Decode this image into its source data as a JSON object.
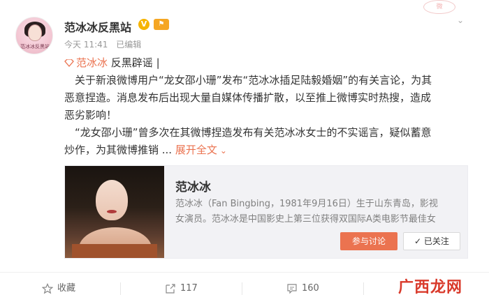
{
  "header": {
    "avatar_caption": "范冰冰反黑站",
    "author_name": "范冰冰反黑站",
    "verified_badge": "V",
    "level_badge": "⚑",
    "time": "今天 11:41",
    "edited": "已编辑"
  },
  "body": {
    "line1_name": "范冰冰",
    "line1_rest": "反黑辟谣 |",
    "line2": "　关于新浪微博用户“龙女邵小珊”发布“范冰冰插足陆毅婚姻”的有关言论，为其",
    "line3": "恶意捏造。消息发布后出现大量自媒体传播扩散，以至推上微博实时热搜，造成",
    "line4": "恶劣影响！",
    "line5": "　“龙女邵小珊”曾多次在其微博捏造发布有关范冰冰女士的不实谣言，疑似蓄意",
    "line6_text": "炒作，为其微博推销 ...",
    "expand_label": "展开全文"
  },
  "card": {
    "title": "范冰冰",
    "desc_line1": "范冰冰（Fan Bingbing，1981年9月16日）生于山东青岛，影视",
    "desc_line2": "女演员。范冰冰是中国影史上第三位获得双国际A类电影节最佳女",
    "join_button": "参与讨论",
    "follow_button": "已关注"
  },
  "actions": {
    "favorite": "收藏",
    "repost_count": "117",
    "comment_count": "160",
    "watermark": "广西龙网"
  },
  "colors": {
    "accent": "#eb7350",
    "card_bg": "#f2f2f5"
  }
}
